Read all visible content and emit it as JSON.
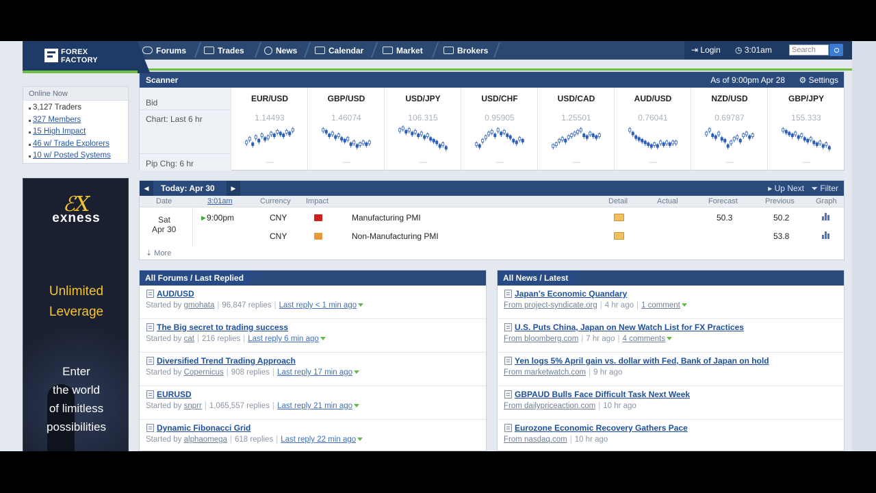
{
  "logo": {
    "line1": "FOREX",
    "line2": "FACTORY"
  },
  "nav": [
    {
      "label": "Forums"
    },
    {
      "label": "Trades"
    },
    {
      "label": "News"
    },
    {
      "label": "Calendar"
    },
    {
      "label": "Market"
    },
    {
      "label": "Brokers"
    }
  ],
  "nav_right": {
    "login": "Login",
    "time": "3:01am",
    "search_placeholder": "Search"
  },
  "online": {
    "title": "Online Now",
    "items": [
      "3,127 Traders",
      "327 Members",
      "15 High Impact",
      "46 w/ Trade Explorers",
      "10 w/ Posted Systems"
    ]
  },
  "ad": {
    "logo_mark": "ℰX",
    "brand": "exness",
    "headline_1": "Unlimited",
    "headline_2": "Leverage",
    "tagline_1": "Enter",
    "tagline_2": "the world",
    "tagline_3": "of limitless",
    "tagline_4": "possibilities"
  },
  "scanner": {
    "title": "Scanner",
    "as_of": "As of 9:00pm Apr 28",
    "settings": "Settings",
    "labels": {
      "bid": "Bid",
      "chart": "Chart: Last 6 hr",
      "pip": "Pip Chg: 6 hr"
    },
    "pairs": [
      {
        "name": "EUR/USD",
        "bid": "1.14493",
        "pip": "—",
        "trend": [
          5,
          7,
          4,
          8,
          6,
          9,
          7,
          8,
          10,
          9,
          11,
          10,
          9,
          11,
          10,
          12
        ]
      },
      {
        "name": "GBP/USD",
        "bid": "1.46074",
        "pip": "—",
        "trend": [
          12,
          11,
          9,
          10,
          8,
          9,
          7,
          6,
          7,
          4,
          5,
          3,
          4,
          5,
          4,
          5
        ]
      },
      {
        "name": "USD/JPY",
        "bid": "106.315",
        "pip": "—",
        "trend": [
          12,
          13,
          11,
          12,
          10,
          11,
          9,
          10,
          8,
          9,
          7,
          6,
          5,
          3,
          4,
          2
        ]
      },
      {
        "name": "USD/CHF",
        "bid": "0.95905",
        "pip": "—",
        "trend": [
          4,
          3,
          6,
          8,
          10,
          11,
          9,
          12,
          10,
          11,
          9,
          8,
          6,
          5,
          7,
          6
        ]
      },
      {
        "name": "USD/CAD",
        "bid": "1.25501",
        "pip": "—",
        "trend": [
          3,
          4,
          6,
          7,
          6,
          8,
          9,
          10,
          11,
          12,
          9,
          8,
          10,
          9,
          8,
          9
        ]
      },
      {
        "name": "AUD/USD",
        "bid": "0.76041",
        "pip": "—",
        "trend": [
          12,
          10,
          8,
          7,
          6,
          5,
          4,
          3,
          4,
          3,
          5,
          4,
          5,
          4,
          5,
          5
        ]
      },
      {
        "name": "NZD/USD",
        "bid": "0.69787",
        "pip": "—",
        "trend": [
          10,
          12,
          9,
          8,
          10,
          7,
          6,
          3,
          5,
          7,
          8,
          6,
          9,
          10,
          8,
          9
        ]
      },
      {
        "name": "GBP/JPY",
        "bid": "155.333",
        "pip": "—",
        "trend": [
          12,
          11,
          10,
          9,
          10,
          8,
          9,
          7,
          6,
          7,
          5,
          4,
          5,
          3,
          4,
          2
        ]
      }
    ]
  },
  "calendar": {
    "today": "Today: Apr 30",
    "up_next": "Up Next",
    "filter": "Filter",
    "columns": {
      "date": "Date",
      "time": "3:01am",
      "currency": "Currency",
      "impact": "Impact",
      "detail": "Detail",
      "actual": "Actual",
      "forecast": "Forecast",
      "previous": "Previous",
      "graph": "Graph"
    },
    "date_day": "Sat",
    "date_md": "Apr 30",
    "rows": [
      {
        "time": "9:00pm",
        "currency": "CNY",
        "impact_color": "#d0201e",
        "event": "Manufacturing PMI",
        "actual": "",
        "forecast": "50.3",
        "previous": "50.2"
      },
      {
        "time": "",
        "currency": "CNY",
        "impact_color": "#e89a3a",
        "event": "Non-Manufacturing PMI",
        "actual": "",
        "forecast": "",
        "previous": "53.8"
      }
    ],
    "more": "More"
  },
  "forums": {
    "title": "All Forums / Last Replied",
    "items": [
      {
        "title": "AUD/USD",
        "by": "gmohata",
        "replies": "96,847 replies",
        "last": "Last reply < 1 min ago"
      },
      {
        "title": "The Big secret to trading success",
        "by": "cat",
        "replies": "216 replies",
        "last": "Last reply 6 min ago"
      },
      {
        "title": "Diversified Trend Trading Approach",
        "by": "Copernicus",
        "replies": "908 replies",
        "last": "Last reply 17 min ago"
      },
      {
        "title": "EURUSD",
        "by": "snprr",
        "replies": "1,065,557 replies",
        "last": "Last reply 21 min ago"
      },
      {
        "title": "Dynamic Fibonacci Grid",
        "by": "alphaomega",
        "replies": "618 replies",
        "last": "Last reply 22 min ago"
      }
    ],
    "started_by": "Started by"
  },
  "news": {
    "title": "All News / Latest",
    "items": [
      {
        "title": "Japan’s Economic Quandary",
        "source": "From project-syndicate.org",
        "age": "4 hr ago",
        "comments": "1 comment"
      },
      {
        "title": "U.S. Puts China, Japan on New Watch List for FX Practices",
        "source": "From bloomberg.com",
        "age": "7 hr ago",
        "comments": "4 comments"
      },
      {
        "title": "Yen logs 5% April gain vs. dollar with Fed, Bank of Japan on hold",
        "source": "From marketwatch.com",
        "age": "9 hr ago",
        "comments": ""
      },
      {
        "title": "GBPAUD Bulls Face Difficult Task Next Week",
        "source": "From dailypriceaction.com",
        "age": "10 hr ago",
        "comments": ""
      },
      {
        "title": "Eurozone Economic Recovery Gathers Pace",
        "source": "From nasdaq.com",
        "age": "10 hr ago",
        "comments": ""
      }
    ]
  },
  "colors": {
    "nav": "#2a4870",
    "accent_green": "#6ec043",
    "link": "#1d4f9b",
    "ad_yellow": "#f5c430"
  }
}
